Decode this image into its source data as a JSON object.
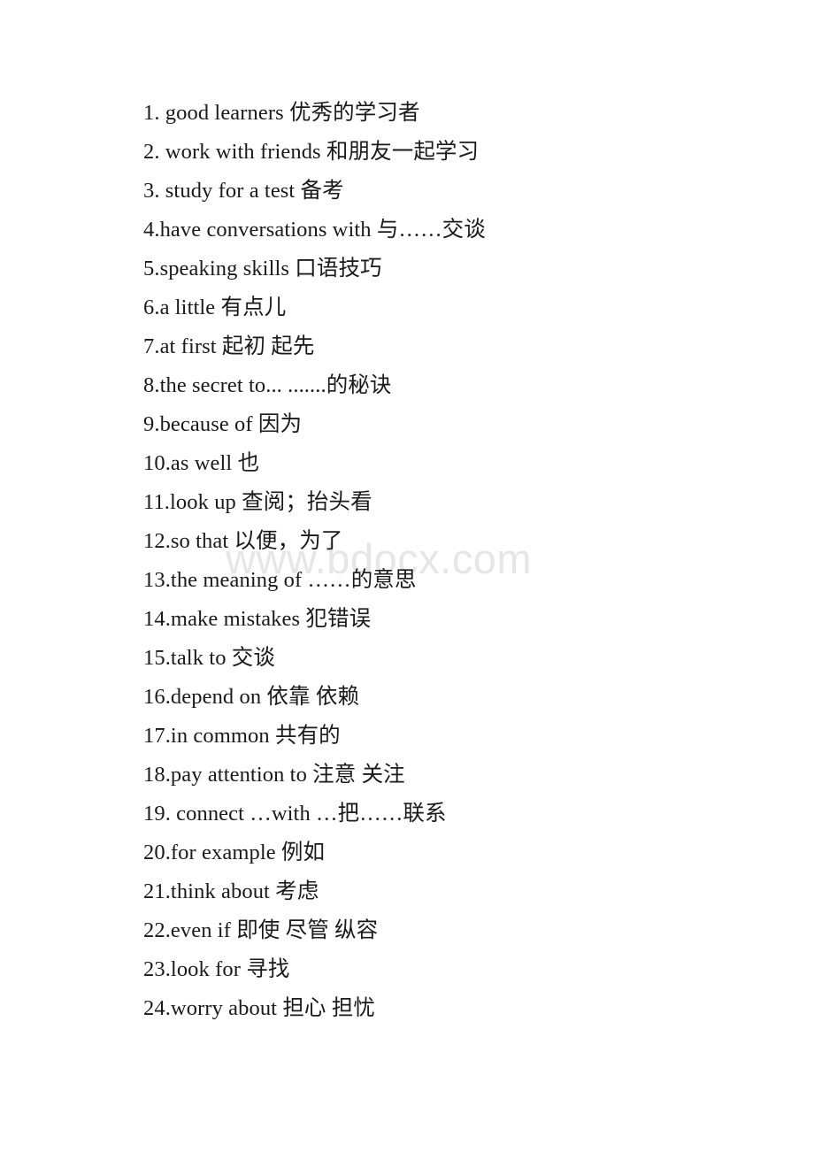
{
  "document": {
    "type": "vocabulary-list",
    "watermark": "www.bdocx.com",
    "entries": [
      "1. good learners 优秀的学习者",
      "2. work with friends 和朋友一起学习",
      "3. study for a test 备考",
      "4.have conversations with 与……交谈",
      "5.speaking skills 口语技巧",
      "6.a little 有点儿",
      "7.at first 起初 起先",
      "8.the secret to... .......的秘诀",
      "9.because of 因为",
      "10.as well 也",
      "11.look up 查阅；抬头看",
      "12.so that 以便，为了",
      "13.the meaning of ……的意思",
      "14.make mistakes 犯错误",
      "15.talk to 交谈",
      "16.depend on 依靠 依赖",
      "17.in common 共有的",
      "18.pay attention to 注意 关注",
      "19. connect …with …把……联系",
      "20.for example 例如",
      "21.think about 考虑",
      "22.even if 即使 尽管 纵容",
      "23.look for 寻找",
      "24.worry about 担心 担忧"
    ]
  }
}
